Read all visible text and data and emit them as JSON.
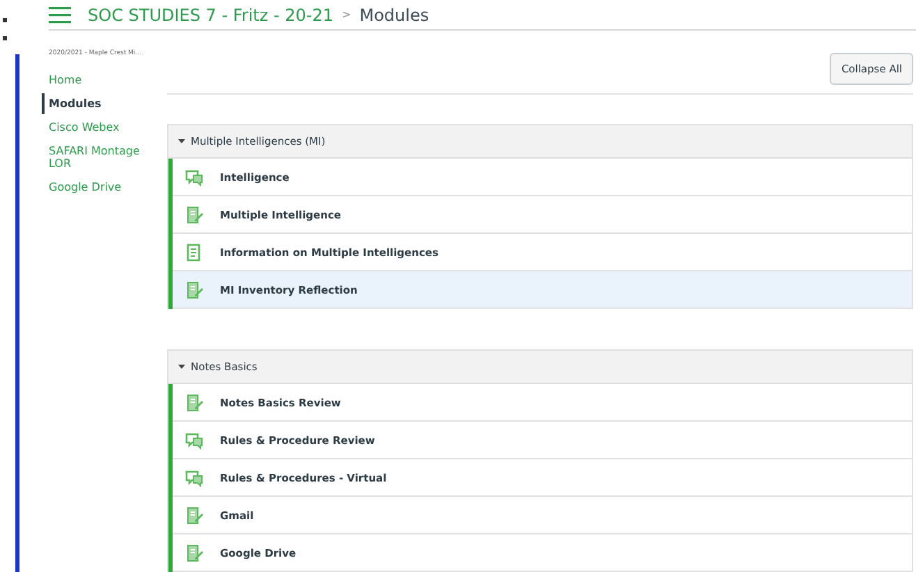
{
  "breadcrumb": {
    "course": "SOC STUDIES 7 - Fritz - 20-21",
    "separator": ">",
    "page": "Modules"
  },
  "sidebar": {
    "term": "2020/2021 - Maple Crest Mi...",
    "items": [
      {
        "label": "Home",
        "selected": false
      },
      {
        "label": "Modules",
        "selected": true
      },
      {
        "label": "Cisco Webex",
        "selected": false
      },
      {
        "label": "SAFARI Montage LOR",
        "selected": false
      },
      {
        "label": "Google Drive",
        "selected": false
      }
    ]
  },
  "toolbar": {
    "button": "Collapse All"
  },
  "modules": [
    {
      "title": "Multiple Intelligences (MI)",
      "expanded": true,
      "items": [
        {
          "kind": "discussion",
          "title": "Intelligence",
          "selected": false
        },
        {
          "kind": "assignment",
          "title": "Multiple Intelligence",
          "selected": false
        },
        {
          "kind": "page",
          "title": "Information on Multiple Intelligences",
          "selected": false
        },
        {
          "kind": "assignment",
          "title": "MI Inventory Reflection",
          "selected": true
        }
      ]
    },
    {
      "title": "Notes Basics",
      "expanded": true,
      "items": [
        {
          "kind": "assignment",
          "title": "Notes Basics Review",
          "selected": false
        },
        {
          "kind": "discussion",
          "title": "Rules & Procedure Review",
          "selected": false
        },
        {
          "kind": "discussion",
          "title": "Rules & Procedures - Virtual",
          "selected": false
        },
        {
          "kind": "assignment",
          "title": "Gmail",
          "selected": false
        },
        {
          "kind": "assignment",
          "title": "Google Drive",
          "selected": false
        }
      ]
    }
  ]
}
